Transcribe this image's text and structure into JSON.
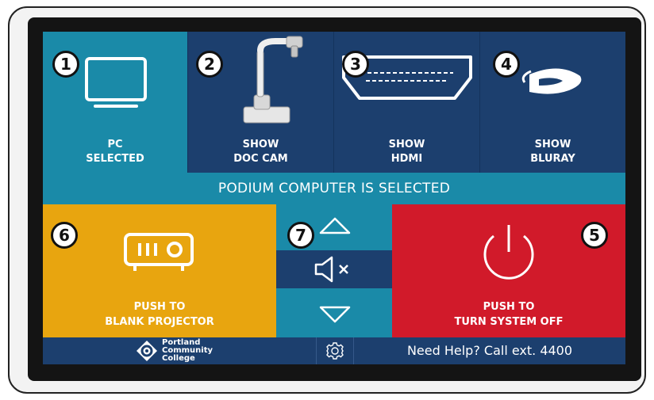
{
  "sources": [
    {
      "id": "pc",
      "number": "1",
      "line1": "PC",
      "line2": "SELECTED",
      "icon": "monitor-icon",
      "selected": true
    },
    {
      "id": "doc-cam",
      "number": "2",
      "line1": "SHOW",
      "line2": "DOC CAM",
      "icon": "document-camera-icon",
      "selected": false
    },
    {
      "id": "hdmi",
      "number": "3",
      "line1": "SHOW",
      "line2": "HDMI",
      "icon": "hdmi-port-icon",
      "selected": false
    },
    {
      "id": "bluray",
      "number": "4",
      "line1": "SHOW",
      "line2": "BLURAY",
      "icon": "bluray-logo-icon",
      "selected": false
    }
  ],
  "status_text": "PODIUM COMPUTER IS SELECTED",
  "projector": {
    "number": "6",
    "line1": "PUSH TO",
    "line2": "BLANK PROJECTOR",
    "icon": "projector-icon"
  },
  "volume": {
    "number": "7",
    "icons": [
      "volume-up-icon",
      "mute-icon",
      "volume-down-icon"
    ]
  },
  "power": {
    "number": "5",
    "line1": "PUSH TO",
    "line2": "TURN SYSTEM OFF",
    "icon": "power-icon"
  },
  "footer": {
    "logo_lines": [
      "Portland",
      "Community",
      "College"
    ],
    "settings_icon": "gear-icon",
    "help_text": "Need Help? Call ext. 4400"
  },
  "colors": {
    "navy": "#1c3f6e",
    "teal": "#1a8aa8",
    "yellow": "#e8a50f",
    "red": "#d11a2a"
  }
}
